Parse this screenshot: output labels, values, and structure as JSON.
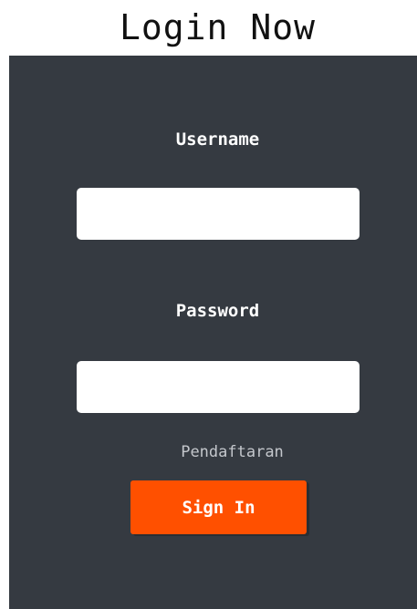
{
  "title": "Login Now",
  "form": {
    "username_label": "Username",
    "username_value": "",
    "password_label": "Password",
    "password_value": "",
    "register_link": "Pendaftaran",
    "signin_label": "Sign In"
  },
  "colors": {
    "panel_bg": "#353a41",
    "button_bg": "#ff5000",
    "link_text": "#c4c7cc"
  }
}
